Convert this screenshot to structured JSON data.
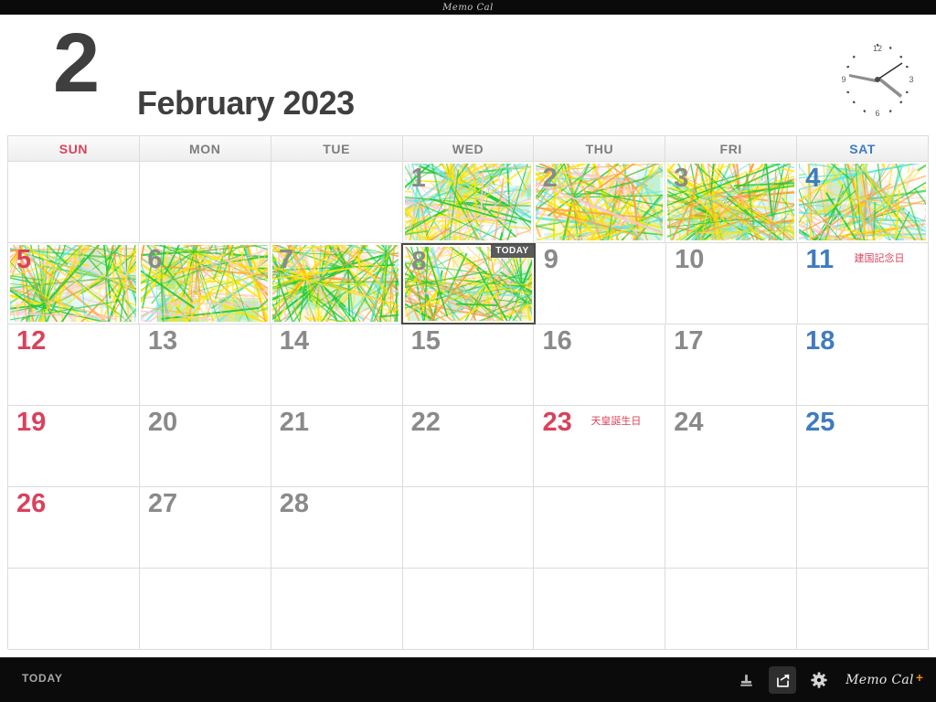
{
  "app": {
    "title": "Memo Cal",
    "brand_name": "Memo Cal",
    "brand_plus": "+"
  },
  "header": {
    "month_number": "2",
    "month_name": "February 2023"
  },
  "clock": {
    "n12": "12",
    "n3": "3",
    "n6": "6",
    "n9": "9"
  },
  "calendar": {
    "weekday_headers": [
      {
        "label": "SUN",
        "kind": "sun"
      },
      {
        "label": "MON",
        "kind": "weekday"
      },
      {
        "label": "TUE",
        "kind": "weekday"
      },
      {
        "label": "WED",
        "kind": "weekday"
      },
      {
        "label": "THU",
        "kind": "weekday"
      },
      {
        "label": "FRI",
        "kind": "weekday"
      },
      {
        "label": "SAT",
        "kind": "sat"
      }
    ],
    "today_badge": "TODAY",
    "weeks": [
      [
        {
          "day": "",
          "kind": "sun",
          "memo": false,
          "today": false,
          "holiday": ""
        },
        {
          "day": "",
          "kind": "weekday",
          "memo": false,
          "today": false,
          "holiday": ""
        },
        {
          "day": "",
          "kind": "weekday",
          "memo": false,
          "today": false,
          "holiday": ""
        },
        {
          "day": "1",
          "kind": "weekday",
          "memo": true,
          "today": false,
          "holiday": ""
        },
        {
          "day": "2",
          "kind": "weekday",
          "memo": true,
          "today": false,
          "holiday": ""
        },
        {
          "day": "3",
          "kind": "weekday",
          "memo": true,
          "today": false,
          "holiday": ""
        },
        {
          "day": "4",
          "kind": "sat",
          "memo": true,
          "today": false,
          "holiday": ""
        }
      ],
      [
        {
          "day": "5",
          "kind": "sun",
          "memo": true,
          "today": false,
          "holiday": ""
        },
        {
          "day": "6",
          "kind": "weekday",
          "memo": true,
          "today": false,
          "holiday": ""
        },
        {
          "day": "7",
          "kind": "weekday",
          "memo": true,
          "today": false,
          "holiday": ""
        },
        {
          "day": "8",
          "kind": "weekday",
          "memo": true,
          "today": true,
          "holiday": ""
        },
        {
          "day": "9",
          "kind": "weekday",
          "memo": false,
          "today": false,
          "holiday": ""
        },
        {
          "day": "10",
          "kind": "weekday",
          "memo": false,
          "today": false,
          "holiday": ""
        },
        {
          "day": "11",
          "kind": "sat",
          "memo": false,
          "today": false,
          "holiday": "建国記念日"
        }
      ],
      [
        {
          "day": "12",
          "kind": "sun",
          "memo": false,
          "today": false,
          "holiday": ""
        },
        {
          "day": "13",
          "kind": "weekday",
          "memo": false,
          "today": false,
          "holiday": ""
        },
        {
          "day": "14",
          "kind": "weekday",
          "memo": false,
          "today": false,
          "holiday": ""
        },
        {
          "day": "15",
          "kind": "weekday",
          "memo": false,
          "today": false,
          "holiday": ""
        },
        {
          "day": "16",
          "kind": "weekday",
          "memo": false,
          "today": false,
          "holiday": ""
        },
        {
          "day": "17",
          "kind": "weekday",
          "memo": false,
          "today": false,
          "holiday": ""
        },
        {
          "day": "18",
          "kind": "sat",
          "memo": false,
          "today": false,
          "holiday": ""
        }
      ],
      [
        {
          "day": "19",
          "kind": "sun",
          "memo": false,
          "today": false,
          "holiday": ""
        },
        {
          "day": "20",
          "kind": "weekday",
          "memo": false,
          "today": false,
          "holiday": ""
        },
        {
          "day": "21",
          "kind": "weekday",
          "memo": false,
          "today": false,
          "holiday": ""
        },
        {
          "day": "22",
          "kind": "weekday",
          "memo": false,
          "today": false,
          "holiday": ""
        },
        {
          "day": "23",
          "kind": "holiday",
          "memo": false,
          "today": false,
          "holiday": "天皇誕生日"
        },
        {
          "day": "24",
          "kind": "weekday",
          "memo": false,
          "today": false,
          "holiday": ""
        },
        {
          "day": "25",
          "kind": "sat",
          "memo": false,
          "today": false,
          "holiday": ""
        }
      ],
      [
        {
          "day": "26",
          "kind": "sun",
          "memo": false,
          "today": false,
          "holiday": ""
        },
        {
          "day": "27",
          "kind": "weekday",
          "memo": false,
          "today": false,
          "holiday": ""
        },
        {
          "day": "28",
          "kind": "weekday",
          "memo": false,
          "today": false,
          "holiday": ""
        },
        {
          "day": "",
          "kind": "weekday",
          "memo": false,
          "today": false,
          "holiday": ""
        },
        {
          "day": "",
          "kind": "weekday",
          "memo": false,
          "today": false,
          "holiday": ""
        },
        {
          "day": "",
          "kind": "weekday",
          "memo": false,
          "today": false,
          "holiday": ""
        },
        {
          "day": "",
          "kind": "sat",
          "memo": false,
          "today": false,
          "holiday": ""
        }
      ],
      [
        {
          "day": "",
          "kind": "sun",
          "memo": false,
          "today": false,
          "holiday": ""
        },
        {
          "day": "",
          "kind": "weekday",
          "memo": false,
          "today": false,
          "holiday": ""
        },
        {
          "day": "",
          "kind": "weekday",
          "memo": false,
          "today": false,
          "holiday": ""
        },
        {
          "day": "",
          "kind": "weekday",
          "memo": false,
          "today": false,
          "holiday": ""
        },
        {
          "day": "",
          "kind": "weekday",
          "memo": false,
          "today": false,
          "holiday": ""
        },
        {
          "day": "",
          "kind": "weekday",
          "memo": false,
          "today": false,
          "holiday": ""
        },
        {
          "day": "",
          "kind": "sat",
          "memo": false,
          "today": false,
          "holiday": ""
        }
      ]
    ]
  },
  "toolbar": {
    "today_label": "TODAY",
    "icons": [
      {
        "name": "stamp-icon",
        "active": false
      },
      {
        "name": "share-icon",
        "active": true
      },
      {
        "name": "gear-icon",
        "active": false
      }
    ]
  },
  "colors": {
    "sunday": "#d9425c",
    "saturday": "#3f7cc0",
    "weekday": "#8a8a8a",
    "holiday": "#d9425c",
    "brand_accent": "#e08a20",
    "toolbar_bg": "#0b0b0b",
    "grid_line": "#dcdcdc",
    "scribble_green": "#22cc33",
    "scribble_yellow": "#ffe600",
    "scribble_cyan": "#66e6e0",
    "scribble_orange": "#ffa040",
    "scribble_pink": "#ffc8d8"
  }
}
